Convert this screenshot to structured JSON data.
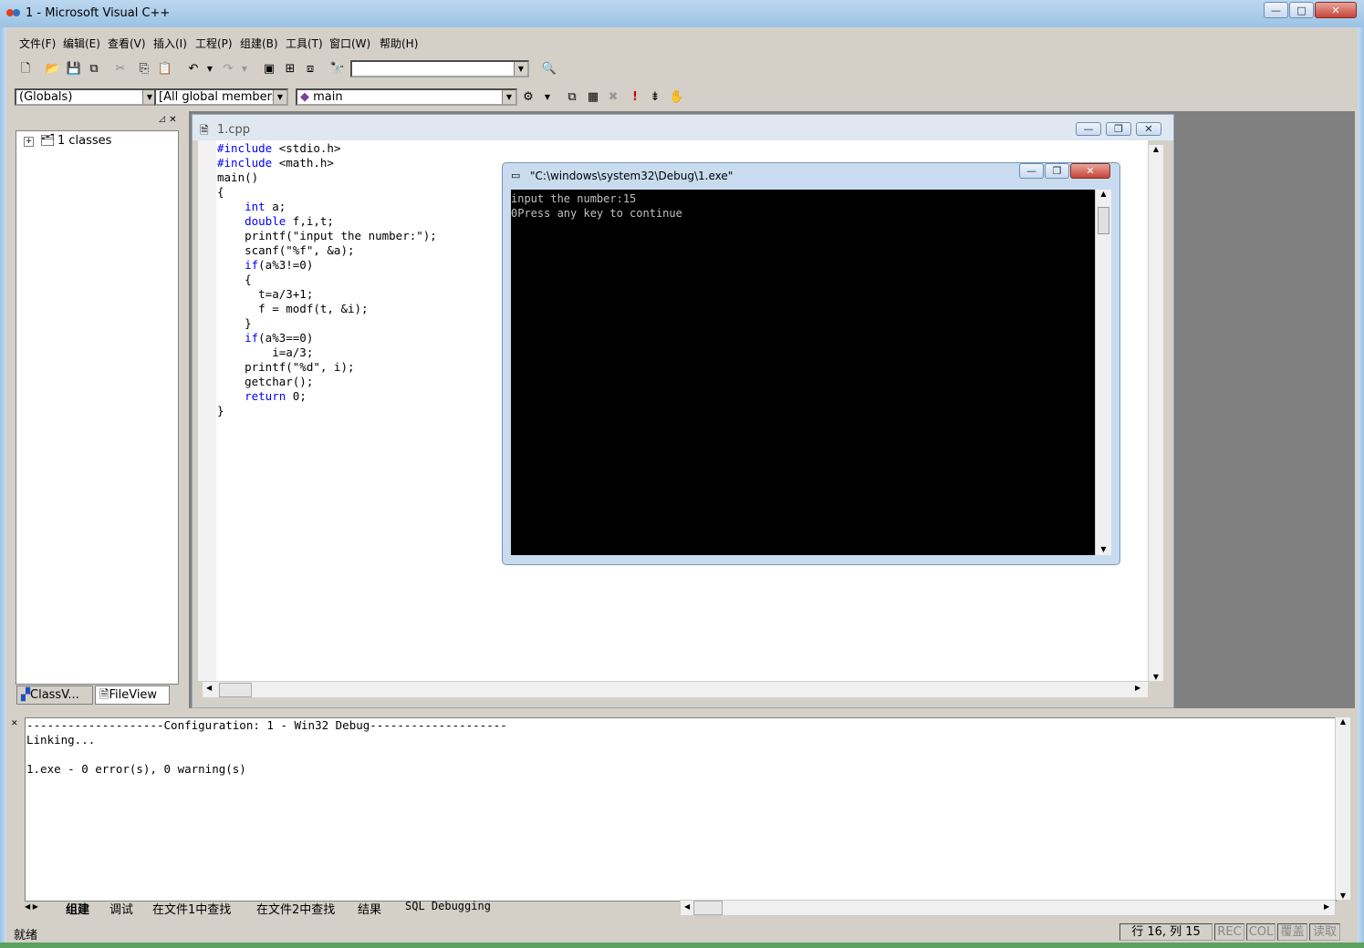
{
  "window": {
    "title": "1 - Microsoft Visual C++",
    "min_label": "—",
    "max_label": "□",
    "close_label": "✕"
  },
  "menu": [
    "文件(F)",
    "编辑(E)",
    "查看(V)",
    "插入(I)",
    "工程(P)",
    "组建(B)",
    "工具(T)",
    "窗口(W)",
    "帮助(H)"
  ],
  "toolbar": {
    "find_value": ""
  },
  "wizardbar": {
    "scope": "(Globals)",
    "members": "[All global members",
    "function": "main"
  },
  "workspace": {
    "tree_root": "1 classes",
    "tab_classview": "ClassV...",
    "tab_fileview": "FileView"
  },
  "editor": {
    "title": "1.cpp",
    "lines": [
      {
        "kw": "#include",
        "rest": " <stdio.h>"
      },
      {
        "kw": "#include",
        "rest": " <math.h>"
      },
      {
        "kw": "",
        "rest": "main()"
      },
      {
        "kw": "",
        "rest": "{"
      },
      {
        "kw": "    int",
        "rest": " a;"
      },
      {
        "kw": "    double",
        "rest": " f,i,t;"
      },
      {
        "kw": "",
        "rest": "    printf(\"input the number:\");"
      },
      {
        "kw": "",
        "rest": "    scanf(\"%f\", &a);"
      },
      {
        "kw": "    if",
        "rest": "(a%3!=0)"
      },
      {
        "kw": "",
        "rest": "    {"
      },
      {
        "kw": "",
        "rest": "      t=a/3+1;"
      },
      {
        "kw": "",
        "rest": "      f = modf(t, &i);"
      },
      {
        "kw": "",
        "rest": "    }"
      },
      {
        "kw": "    if",
        "rest": "(a%3==0)"
      },
      {
        "kw": "",
        "rest": "        i=a/3;"
      },
      {
        "kw": "",
        "rest": "    printf(\"%d\", i);"
      },
      {
        "kw": "",
        "rest": "    getchar();"
      },
      {
        "kw": "    return",
        "rest": " 0;"
      },
      {
        "kw": "",
        "rest": "}"
      }
    ]
  },
  "console": {
    "title": "\"C:\\windows\\system32\\Debug\\1.exe\"",
    "line1": "input the number:15",
    "line2": "0Press any key to continue"
  },
  "output": {
    "line1": "--------------------Configuration: 1 - Win32 Debug--------------------",
    "line2": "Linking...",
    "line3": "",
    "line4": "1.exe - 0 error(s), 0 warning(s)",
    "tabs": [
      "组建",
      "调试",
      "在文件1中查找",
      "在文件2中查找",
      "结果",
      "SQL Debugging"
    ]
  },
  "status": {
    "ready": "就绪",
    "position": "行 16, 列 15",
    "rec": "REC",
    "col": "COL",
    "ovr": "覆盖",
    "read": "读取"
  }
}
